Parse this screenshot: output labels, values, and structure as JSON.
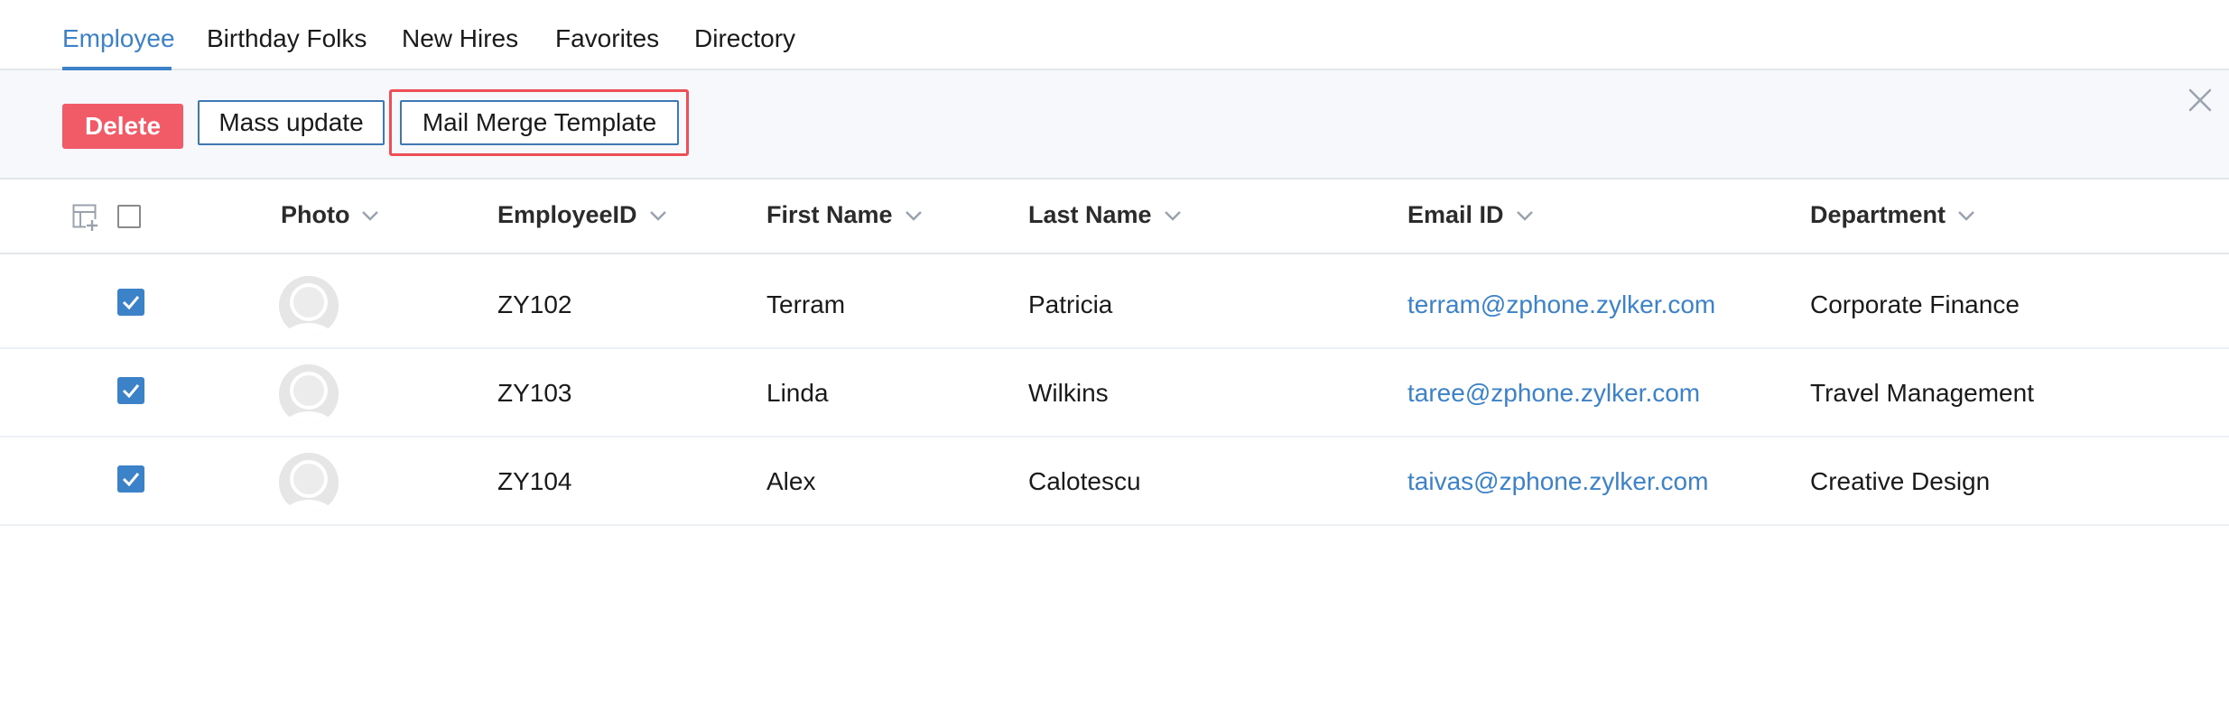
{
  "tabs": [
    {
      "label": "Employee",
      "active": true
    },
    {
      "label": "Birthday Folks",
      "active": false
    },
    {
      "label": "New Hires",
      "active": false
    },
    {
      "label": "Favorites",
      "active": false
    },
    {
      "label": "Directory",
      "active": false
    }
  ],
  "actions": {
    "delete_label": "Delete",
    "mass_update_label": "Mass update",
    "mail_merge_label": "Mail Merge Template"
  },
  "table": {
    "columns": [
      "Photo",
      "EmployeeID",
      "First Name",
      "Last Name",
      "Email ID",
      "Department"
    ],
    "rows": [
      {
        "checked": true,
        "employee_id": "ZY102",
        "first_name": "Terram",
        "last_name": "Patricia",
        "email": "terram@zphone.zylker.com",
        "department": "Corporate Finance"
      },
      {
        "checked": true,
        "employee_id": "ZY103",
        "first_name": "Linda",
        "last_name": "Wilkins",
        "email": "taree@zphone.zylker.com",
        "department": "Travel Management"
      },
      {
        "checked": true,
        "employee_id": "ZY104",
        "first_name": "Alex",
        "last_name": "Calotescu",
        "email": "taivas@zphone.zylker.com",
        "department": "Creative Design"
      }
    ]
  },
  "colors": {
    "accent": "#3b82c9",
    "delete": "#f15a67",
    "highlight": "#ee4f57",
    "toolbar_bg": "#f6f8fb"
  },
  "icons": {
    "close": "close-icon",
    "column_settings": "column-settings-icon",
    "sort": "chevron-down-icon",
    "checkbox": "checkmark-icon",
    "avatar": "user-avatar-icon"
  }
}
